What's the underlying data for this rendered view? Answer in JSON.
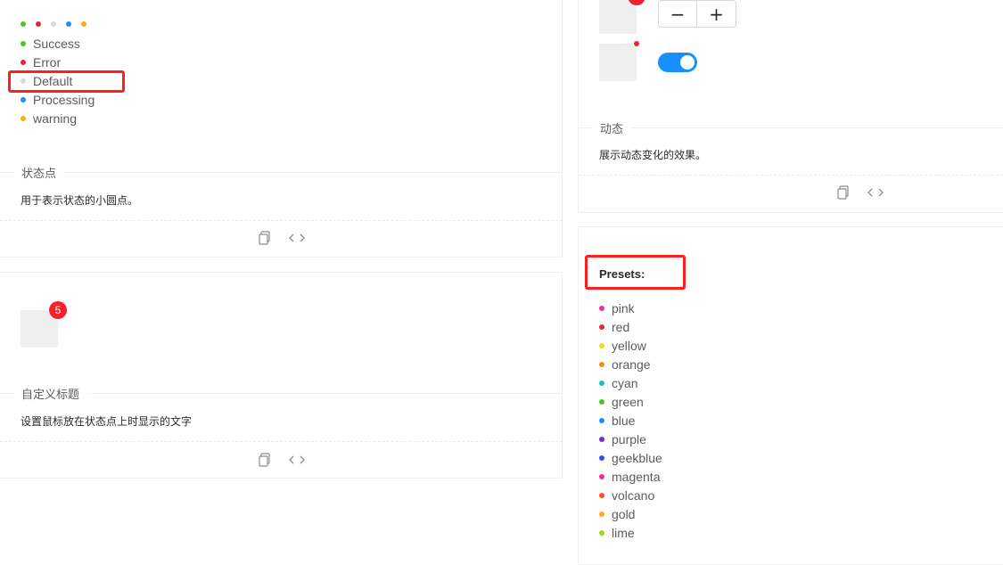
{
  "colors": {
    "success": "#52c41a",
    "error": "#f5222d",
    "default": "#d9d9d9",
    "processing": "#1890ff",
    "warning": "#faad14",
    "badge": "#f5222d",
    "switch_on": "#1890ff",
    "highlight_box": "#ff1f1f"
  },
  "left_status_card": {
    "top_dot_row": [
      "success",
      "error",
      "default",
      "processing",
      "warning"
    ],
    "statuses": [
      {
        "label": "Success",
        "color": "#52c41a"
      },
      {
        "label": "Error",
        "color": "#f5222d"
      },
      {
        "label": "Default",
        "color": "#d9d9d9"
      },
      {
        "label": "Processing",
        "color": "#1890ff"
      },
      {
        "label": "warning",
        "color": "#faad14"
      }
    ],
    "section_title": "状态点",
    "description": "用于表示状态的小圆点。",
    "actions": {
      "copy_icon": "copy-icon",
      "code_icon": "code-icon"
    }
  },
  "left_title_card": {
    "badge_count": "5",
    "section_title": "自定义标题",
    "description": "设置鼠标放在状态点上时显示的文字",
    "actions": {
      "copy_icon": "copy-icon",
      "code_icon": "code-icon"
    }
  },
  "right_dynamic_card": {
    "minus_label": "−",
    "plus_label": "+",
    "switch_checked": true,
    "section_title": "动态",
    "description": "展示动态变化的效果。",
    "actions": {
      "copy_icon": "copy-icon",
      "code_icon": "code-icon"
    }
  },
  "right_presets_card": {
    "heading": "Presets:",
    "presets": [
      {
        "label": "pink",
        "color": "#eb2f96"
      },
      {
        "label": "red",
        "color": "#f5222d"
      },
      {
        "label": "yellow",
        "color": "#fadb14"
      },
      {
        "label": "orange",
        "color": "#fa8c16"
      },
      {
        "label": "cyan",
        "color": "#13c2c2"
      },
      {
        "label": "green",
        "color": "#52c41a"
      },
      {
        "label": "blue",
        "color": "#1890ff"
      },
      {
        "label": "purple",
        "color": "#722ed1"
      },
      {
        "label": "geekblue",
        "color": "#2f54eb"
      },
      {
        "label": "magenta",
        "color": "#eb2f96"
      },
      {
        "label": "volcano",
        "color": "#fa541c"
      },
      {
        "label": "gold",
        "color": "#faad14"
      },
      {
        "label": "lime",
        "color": "#a0d911"
      }
    ]
  }
}
